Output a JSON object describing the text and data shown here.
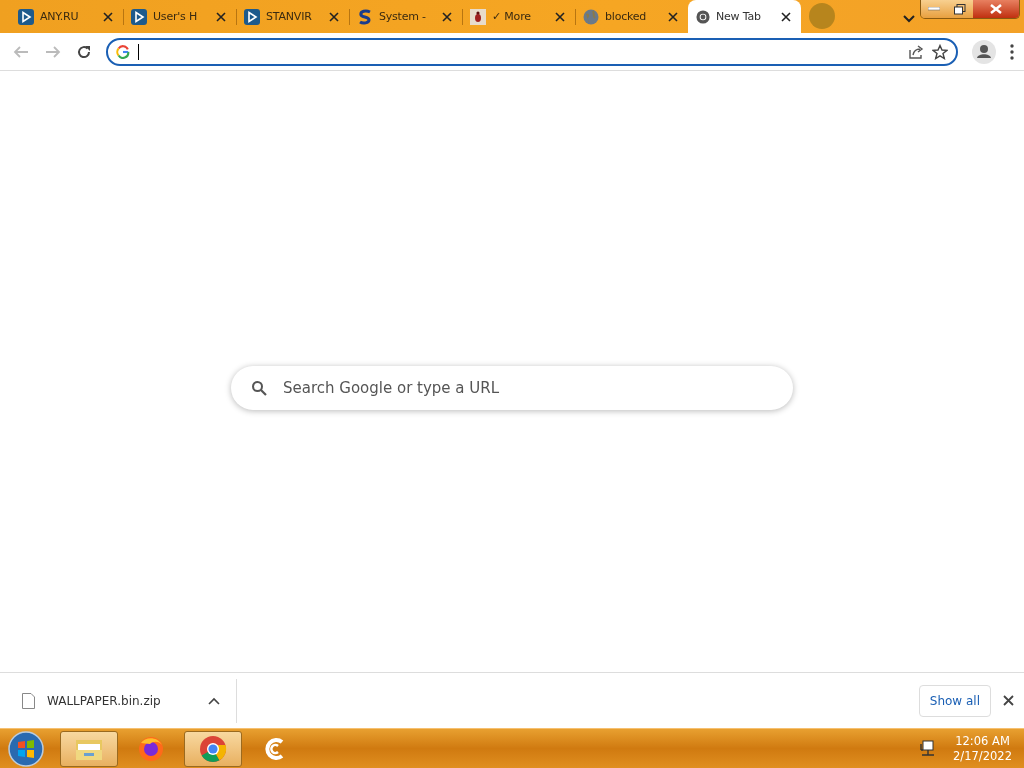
{
  "tabs": [
    {
      "title": "ANY.RU",
      "kind": "play",
      "selected": false
    },
    {
      "title": "User's H",
      "kind": "play",
      "selected": false
    },
    {
      "title": "STANVIR",
      "kind": "play",
      "selected": false
    },
    {
      "title": "System -",
      "kind": "s-logo",
      "selected": false
    },
    {
      "title": "✓ More",
      "kind": "bug",
      "selected": false
    },
    {
      "title": "blocked",
      "kind": "globe",
      "selected": false
    },
    {
      "title": "New Tab",
      "kind": "chrome",
      "selected": true
    }
  ],
  "search": {
    "placeholder": "Search Google or type a URL"
  },
  "download_bar": {
    "filename": "WALLPAPER.bin.zip",
    "button": "Show all"
  },
  "taskbar": {
    "apps": [
      {
        "kind": "folder",
        "highlighted": true
      },
      {
        "kind": "firefox",
        "highlighted": false
      },
      {
        "kind": "chrome",
        "highlighted": true
      },
      {
        "kind": "ccleaner",
        "highlighted": false
      }
    ],
    "time": "12:06 AM",
    "date": "2/17/2022"
  }
}
